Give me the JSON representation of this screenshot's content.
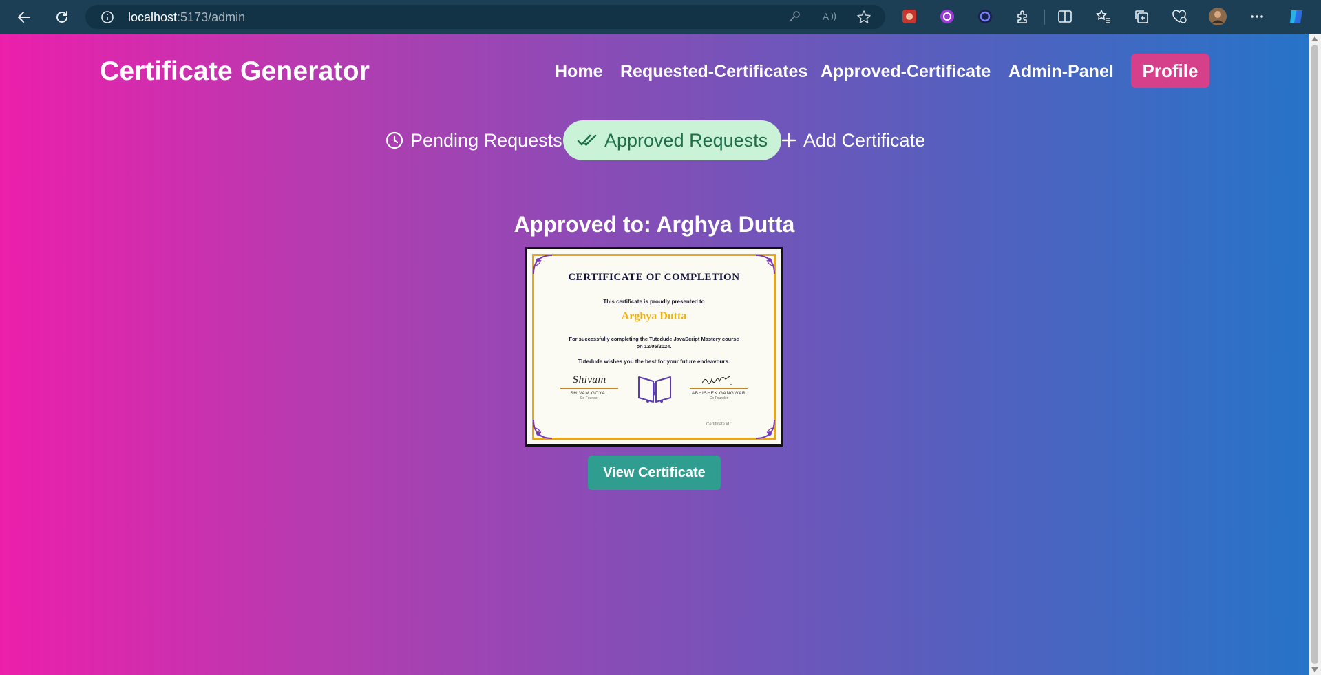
{
  "browser": {
    "url_host": "localhost",
    "url_path": ":5173/admin"
  },
  "navbar": {
    "brand": "Certificate Generator",
    "links": [
      "Home",
      "Requested-Certificates",
      "Approved-Certificate",
      "Admin-Panel"
    ],
    "profile_label": "Profile"
  },
  "tabs": {
    "pending": "Pending Requests",
    "approved": "Approved Requests",
    "add": "Add Certificate",
    "active": "approved"
  },
  "approval": {
    "title": "Approved to: Arghya Dutta",
    "view_button": "View Certificate"
  },
  "certificate": {
    "heading": "CERTIFICATE OF COMPLETION",
    "presented": "This certificate is proudly presented to",
    "recipient": "Arghya Dutta",
    "description": "For successfully completing the Tutedude JavaScript Mastery course on 12/05/2024.",
    "wishes": "Tutedude wishes you the best for your future endeavours.",
    "signer_left_name": "SHIVAM GOYAL",
    "signer_left_role": "Co-Founder",
    "signer_left_signature": "Shivam",
    "signer_right_name": "ABHISHEK GANGWAR",
    "signer_right_role": "Co-Founder",
    "certificate_id_label": "Certificate id :"
  },
  "colors": {
    "gradient_left": "#ec1fab",
    "gradient_right": "#2674c8",
    "profile_button": "#d6408a",
    "active_tab_bg": "#c9f2d6",
    "active_tab_text": "#1f6f4b",
    "view_button": "#2f9d8f",
    "cert_gold": "#e0a72b"
  },
  "icons": {
    "pending": "clock-icon",
    "approved": "double-check-icon",
    "add": "plus-icon"
  }
}
